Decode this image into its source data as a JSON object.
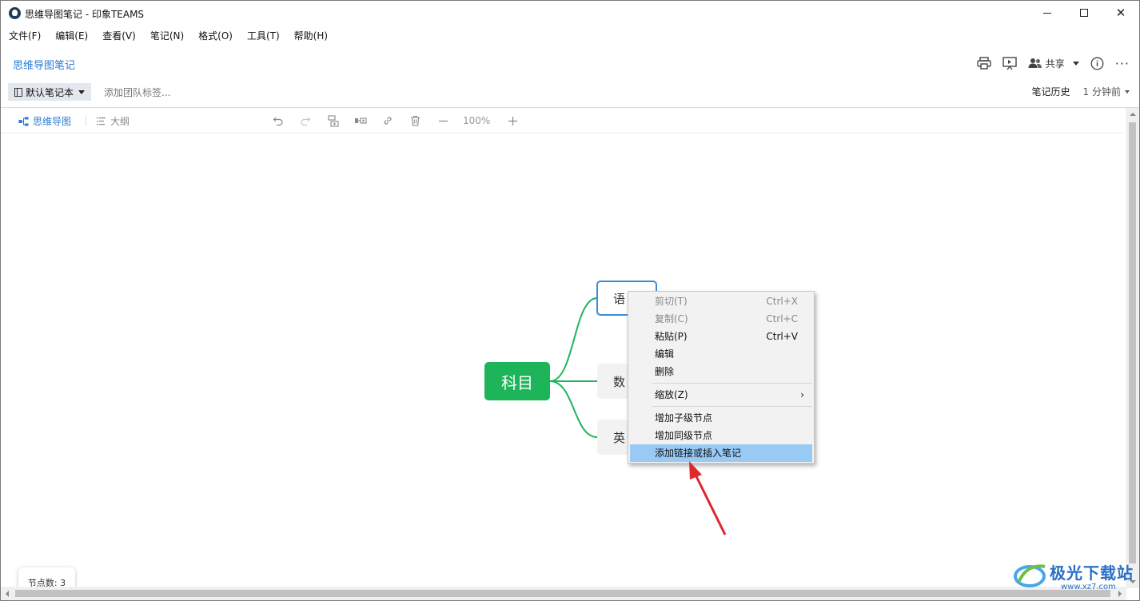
{
  "window": {
    "title": "思维导图笔记 - 印象TEAMS"
  },
  "menubar": {
    "items": [
      "文件(F)",
      "编辑(E)",
      "查看(V)",
      "笔记(N)",
      "格式(O)",
      "工具(T)",
      "帮助(H)"
    ]
  },
  "note": {
    "title": "思维导图笔记",
    "share_label": "共享",
    "notebook_label": "默认笔记本",
    "tag_placeholder": "添加团队标签...",
    "history_label": "笔记历史",
    "updated_label": "1 分钟前"
  },
  "editor": {
    "tab_mindmap": "思维导图",
    "tab_outline": "大纲",
    "zoom": "100%",
    "node_count_label": "节点数: 3"
  },
  "mindmap": {
    "root": "科目",
    "children": [
      "语",
      "数",
      "英"
    ],
    "selected_child": 0,
    "line_color": "#1db45a",
    "root_color": "#1db45a",
    "selected_border": "#3c8bd8"
  },
  "context_menu": {
    "cut": {
      "label": "剪切(T)",
      "shortcut": "Ctrl+X",
      "enabled": false
    },
    "copy": {
      "label": "复制(C)",
      "shortcut": "Ctrl+C",
      "enabled": false
    },
    "paste": {
      "label": "粘贴(P)",
      "shortcut": "Ctrl+V",
      "enabled": true
    },
    "edit": {
      "label": "编辑"
    },
    "delete": {
      "label": "删除"
    },
    "zoom": {
      "label": "缩放(Z)",
      "arrow": "›"
    },
    "add_child": {
      "label": "增加子级节点"
    },
    "add_sibling": {
      "label": "增加同级节点"
    },
    "add_link": {
      "label": "添加链接或插入笔记",
      "highlighted": true
    }
  },
  "watermark": {
    "text": "极光下载站",
    "url": "www.xz7.com"
  },
  "colors": {
    "accent": "#2b7bd3",
    "highlight": "#99c9f5",
    "annotation_arrow": "#e0272b"
  }
}
